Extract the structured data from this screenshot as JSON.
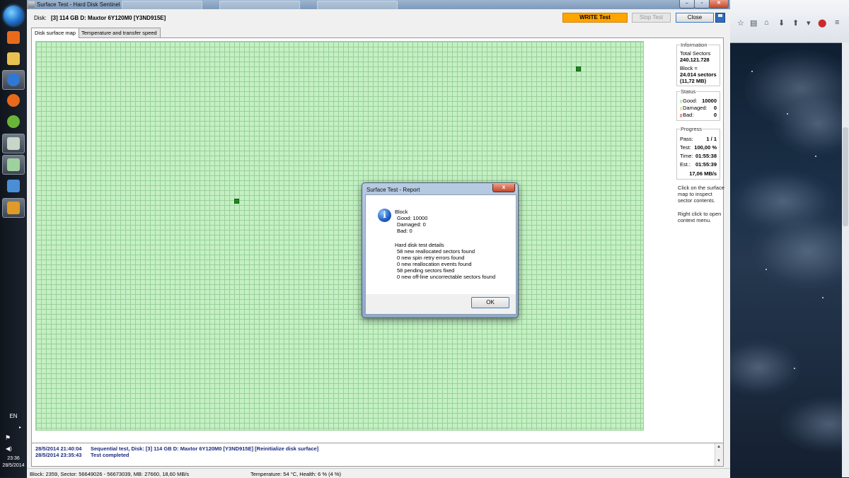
{
  "taskbar": {
    "language": "EN",
    "clock_time": "23:36",
    "clock_date": "28/5/2014",
    "apps": [
      {
        "name": "media-player-icon",
        "color": "#e86b1b"
      },
      {
        "name": "file-explorer-icon",
        "color": "#e8c250"
      },
      {
        "name": "browser-globe-icon",
        "color": "#2f78d6"
      },
      {
        "name": "firefox-icon",
        "color": "#e66a1a"
      },
      {
        "name": "utorrent-icon",
        "color": "#6ab43a"
      },
      {
        "name": "disk-sentinel-icon",
        "color": "#c7d6c8"
      },
      {
        "name": "hard-disk-icon",
        "color": "#9fd19f"
      },
      {
        "name": "network-monitor-icon",
        "color": "#4a8fd6"
      },
      {
        "name": "tools-icon",
        "color": "#e09a2a"
      }
    ]
  },
  "window": {
    "title": "Surface Test - Hard Disk Sentinel",
    "min_label": "–",
    "max_label": "▫",
    "close_label": "✕"
  },
  "header": {
    "disk_label": "Disk:",
    "disk_value": "[3] 114 GB D: Maxtor 6Y120M0 [Y3ND915E]",
    "write_test": "WRITE Test",
    "stop_test": "Stop Test",
    "close": "Close"
  },
  "tabs": [
    "Disk surface map",
    "Temperature and transfer speed"
  ],
  "info": {
    "title": "Information",
    "total_sectors_label": "Total Sectors",
    "total_sectors": "240.121.728",
    "block_label": "Block =",
    "block_sectors": "24.014 sectors",
    "block_size": "(11,72 MB)"
  },
  "status": {
    "title": "Status",
    "good_label": "Good:",
    "good": "10000",
    "damaged_label": "Damaged:",
    "damaged": "0",
    "bad_label": "Bad:",
    "bad": "0",
    "colors": {
      "good": "#c4f0c4",
      "damaged": "#e8e8a0",
      "bad": "#e8a0a0"
    }
  },
  "progress": {
    "title": "Progress",
    "pass_label": "Pass:",
    "pass": "1 / 1",
    "test_label": "Test:",
    "test": "100,00 %",
    "time_label": "Time:",
    "time": "01:55:38",
    "est_label": "Est.:",
    "est": "01:55:39",
    "speed": "17,06 MB/s"
  },
  "help": {
    "click_hint": "Click on the surface map to inspect sector contents.",
    "right_click_hint": "Right click to open context menu."
  },
  "log": [
    {
      "time": "28/5/2014  21:40:04",
      "text": "Sequential test, Disk: [3] 114 GB D: Maxtor 6Y120M0 [Y3ND915E] [Reinitialize disk surface]"
    },
    {
      "time": "28/5/2014  23:35:43",
      "text": "Test completed"
    }
  ],
  "statusbar": {
    "left": "Block: 2359, Sector: 56649026 - 56673039, MB: 27660, 18,60 MB/s",
    "right": "Temperature: 54  °C,  Health: 6 % (4 %)"
  },
  "dialog": {
    "title": "Surface Test - Report",
    "close_label": "x",
    "block_heading": "Block",
    "good": "Good: 10000",
    "damaged": "Damaged: 0",
    "bad": "Bad: 0",
    "details_heading": "Hard disk test details",
    "details": [
      "58 new reallocated sectors found",
      "0 new spin retry errors found",
      "0 new reallocation events found",
      "58 pending sectors fixed",
      "0 new off-line uncorrectable sectors found"
    ],
    "ok": "OK"
  }
}
